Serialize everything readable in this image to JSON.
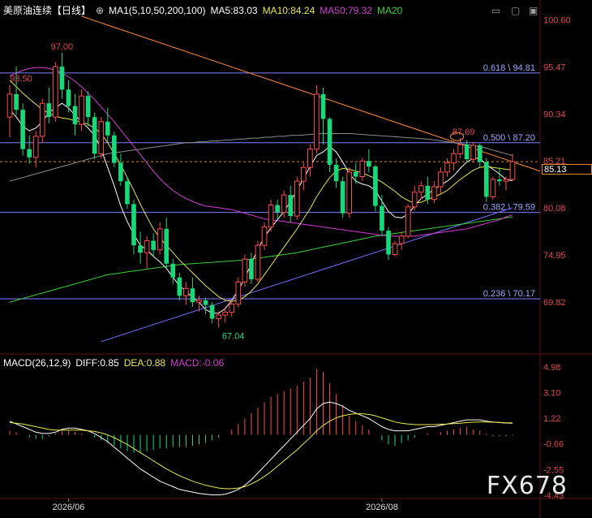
{
  "header": {
    "title": "美原油连续",
    "period": "【日线】",
    "ma_settings": "MA1(5,10,50,200,100)",
    "ma5": "MA5:83.03",
    "ma10": "MA10:84.24",
    "ma50": "MA50:79.32",
    "ma20": "MA20"
  },
  "macd_header": {
    "settings": "MACD(26,12,9)",
    "diff": "DIFF:0.85",
    "dea": "DEA:0.88",
    "macd": "MACD:-0.06"
  },
  "price_axis_labels": [
    "100.60",
    "95.47",
    "90.34",
    "85.21",
    "80.08",
    "74.95",
    "69.82"
  ],
  "macd_axis_labels": [
    "4.98",
    "3.10",
    "1.22",
    "-0.66",
    "-2.55",
    "-4.43"
  ],
  "date_labels": [
    "2026/06",
    "2026/08"
  ],
  "fib_levels": [
    {
      "label": "0.618 \\ 94.81",
      "value": 94.81
    },
    {
      "label": "0.500 \\ 87.20",
      "value": 87.2
    },
    {
      "label": "0.382 \\ 79.59",
      "value": 79.59
    },
    {
      "label": "0.236 \\ 70.17",
      "value": 70.17
    }
  ],
  "annotations": {
    "high1": "97.00",
    "high2": "93.50",
    "high3": "87.69",
    "low1": "67.04"
  },
  "last_price": "85.13",
  "watermark": "FX678",
  "colors": {
    "up": "#ff4b4b",
    "down": "#19d87a",
    "ma5": "#ffffff",
    "ma10": "#e8e84a",
    "ma50": "#d23cd2",
    "ma20": "#3ad03a",
    "ma200": "#8c8c8c",
    "fib": "#7f7fff",
    "trend": "#ff8a3c",
    "support": "#7070ff"
  },
  "chart_data": {
    "type": "candlestick",
    "price_range": [
      64.5,
      101.0
    ],
    "macd_range": [
      -4.43,
      4.98
    ],
    "candles": [
      {
        "o": 90.0,
        "h": 93.5,
        "l": 87.8,
        "c": 92.5
      },
      {
        "o": 92.5,
        "h": 95.5,
        "l": 90.2,
        "c": 90.8
      },
      {
        "o": 90.8,
        "h": 91.5,
        "l": 85.8,
        "c": 86.5
      },
      {
        "o": 86.5,
        "h": 88.0,
        "l": 84.9,
        "c": 85.6
      },
      {
        "o": 85.6,
        "h": 88.5,
        "l": 84.5,
        "c": 87.9
      },
      {
        "o": 87.9,
        "h": 92.0,
        "l": 87.2,
        "c": 91.5
      },
      {
        "o": 91.5,
        "h": 93.2,
        "l": 89.3,
        "c": 90.0
      },
      {
        "o": 90.0,
        "h": 96.0,
        "l": 89.5,
        "c": 95.5
      },
      {
        "o": 95.5,
        "h": 97.0,
        "l": 92.0,
        "c": 93.0
      },
      {
        "o": 93.0,
        "h": 94.0,
        "l": 90.5,
        "c": 91.2
      },
      {
        "o": 91.2,
        "h": 92.5,
        "l": 88.0,
        "c": 89.2
      },
      {
        "o": 89.2,
        "h": 93.0,
        "l": 88.5,
        "c": 92.3
      },
      {
        "o": 92.3,
        "h": 92.8,
        "l": 89.0,
        "c": 90.0
      },
      {
        "o": 90.0,
        "h": 90.5,
        "l": 85.4,
        "c": 86.0
      },
      {
        "o": 86.0,
        "h": 90.0,
        "l": 85.5,
        "c": 89.5
      },
      {
        "o": 89.5,
        "h": 91.0,
        "l": 87.3,
        "c": 88.0
      },
      {
        "o": 88.0,
        "h": 88.4,
        "l": 84.5,
        "c": 85.0
      },
      {
        "o": 85.0,
        "h": 86.0,
        "l": 82.5,
        "c": 83.0
      },
      {
        "o": 83.0,
        "h": 83.5,
        "l": 80.0,
        "c": 80.5
      },
      {
        "o": 80.5,
        "h": 81.0,
        "l": 75.0,
        "c": 76.0
      },
      {
        "o": 76.0,
        "h": 77.5,
        "l": 74.0,
        "c": 75.2
      },
      {
        "o": 75.2,
        "h": 77.0,
        "l": 73.5,
        "c": 76.5
      },
      {
        "o": 76.5,
        "h": 77.3,
        "l": 74.8,
        "c": 75.5
      },
      {
        "o": 75.5,
        "h": 78.5,
        "l": 75.0,
        "c": 77.8
      },
      {
        "o": 77.8,
        "h": 79.0,
        "l": 73.5,
        "c": 74.0
      },
      {
        "o": 74.0,
        "h": 74.5,
        "l": 71.8,
        "c": 72.5
      },
      {
        "o": 72.5,
        "h": 73.0,
        "l": 70.0,
        "c": 70.5
      },
      {
        "o": 70.5,
        "h": 72.0,
        "l": 69.5,
        "c": 71.3
      },
      {
        "o": 71.3,
        "h": 72.5,
        "l": 69.3,
        "c": 69.8
      },
      {
        "o": 69.8,
        "h": 70.5,
        "l": 68.8,
        "c": 70.0
      },
      {
        "o": 70.0,
        "h": 70.3,
        "l": 68.5,
        "c": 69.5
      },
      {
        "o": 69.5,
        "h": 69.8,
        "l": 67.5,
        "c": 68.0
      },
      {
        "o": 68.0,
        "h": 68.8,
        "l": 67.04,
        "c": 68.4
      },
      {
        "o": 68.4,
        "h": 69.3,
        "l": 67.6,
        "c": 68.7
      },
      {
        "o": 68.7,
        "h": 70.0,
        "l": 68.2,
        "c": 69.6
      },
      {
        "o": 69.6,
        "h": 72.5,
        "l": 69.2,
        "c": 72.0
      },
      {
        "o": 72.0,
        "h": 75.0,
        "l": 71.5,
        "c": 74.5
      },
      {
        "o": 74.5,
        "h": 75.2,
        "l": 71.8,
        "c": 72.3
      },
      {
        "o": 72.3,
        "h": 76.5,
        "l": 72.0,
        "c": 76.0
      },
      {
        "o": 76.0,
        "h": 78.5,
        "l": 75.5,
        "c": 78.0
      },
      {
        "o": 78.0,
        "h": 81.0,
        "l": 77.5,
        "c": 80.4
      },
      {
        "o": 80.4,
        "h": 81.0,
        "l": 78.8,
        "c": 79.6
      },
      {
        "o": 79.6,
        "h": 82.0,
        "l": 79.0,
        "c": 81.5
      },
      {
        "o": 81.5,
        "h": 82.5,
        "l": 78.5,
        "c": 79.2
      },
      {
        "o": 79.2,
        "h": 83.5,
        "l": 78.8,
        "c": 83.0
      },
      {
        "o": 83.0,
        "h": 85.0,
        "l": 82.0,
        "c": 84.5
      },
      {
        "o": 84.5,
        "h": 87.0,
        "l": 83.5,
        "c": 86.5
      },
      {
        "o": 86.5,
        "h": 93.5,
        "l": 86.0,
        "c": 92.5
      },
      {
        "o": 92.5,
        "h": 93.2,
        "l": 87.0,
        "c": 89.8
      },
      {
        "o": 89.8,
        "h": 90.0,
        "l": 84.0,
        "c": 84.8
      },
      {
        "o": 84.8,
        "h": 85.5,
        "l": 82.3,
        "c": 83.0
      },
      {
        "o": 83.0,
        "h": 83.5,
        "l": 79.0,
        "c": 79.5
      },
      {
        "o": 79.5,
        "h": 84.5,
        "l": 79.0,
        "c": 84.0
      },
      {
        "o": 84.0,
        "h": 85.0,
        "l": 82.7,
        "c": 83.5
      },
      {
        "o": 83.5,
        "h": 85.5,
        "l": 83.0,
        "c": 85.2
      },
      {
        "o": 85.2,
        "h": 86.5,
        "l": 84.0,
        "c": 84.6
      },
      {
        "o": 84.6,
        "h": 84.8,
        "l": 79.7,
        "c": 80.3
      },
      {
        "o": 80.3,
        "h": 81.5,
        "l": 77.0,
        "c": 77.6
      },
      {
        "o": 77.6,
        "h": 78.0,
        "l": 74.4,
        "c": 75.0
      },
      {
        "o": 75.0,
        "h": 76.5,
        "l": 74.8,
        "c": 76.2
      },
      {
        "o": 76.2,
        "h": 77.5,
        "l": 75.5,
        "c": 77.0
      },
      {
        "o": 77.0,
        "h": 80.5,
        "l": 76.8,
        "c": 80.2
      },
      {
        "o": 80.2,
        "h": 82.5,
        "l": 79.8,
        "c": 81.8
      },
      {
        "o": 81.8,
        "h": 83.0,
        "l": 81.0,
        "c": 82.5
      },
      {
        "o": 82.5,
        "h": 83.5,
        "l": 80.5,
        "c": 81.0
      },
      {
        "o": 81.0,
        "h": 83.0,
        "l": 80.6,
        "c": 82.4
      },
      {
        "o": 82.4,
        "h": 84.5,
        "l": 81.5,
        "c": 84.0
      },
      {
        "o": 84.0,
        "h": 85.5,
        "l": 83.5,
        "c": 85.0
      },
      {
        "o": 85.0,
        "h": 86.5,
        "l": 84.2,
        "c": 86.0
      },
      {
        "o": 86.0,
        "h": 87.69,
        "l": 85.5,
        "c": 87.0
      },
      {
        "o": 87.0,
        "h": 87.5,
        "l": 85.0,
        "c": 85.4
      },
      {
        "o": 85.4,
        "h": 87.3,
        "l": 85.0,
        "c": 86.9
      },
      {
        "o": 86.9,
        "h": 87.1,
        "l": 84.5,
        "c": 85.1
      },
      {
        "o": 85.1,
        "h": 85.5,
        "l": 80.7,
        "c": 81.3
      },
      {
        "o": 81.3,
        "h": 83.5,
        "l": 81.0,
        "c": 83.2
      },
      {
        "o": 83.2,
        "h": 84.5,
        "l": 82.5,
        "c": 83.0
      },
      {
        "o": 83.0,
        "h": 83.5,
        "l": 82.0,
        "c": 83.2
      },
      {
        "o": 83.2,
        "h": 86.0,
        "l": 83.0,
        "c": 85.13
      }
    ],
    "ma5": [
      90.8,
      90.0,
      89.0,
      88.5,
      88.8,
      89.5,
      90.5,
      91.0,
      91.5,
      91.0,
      90.2,
      89.5,
      88.8,
      88.0,
      86.5,
      84.5,
      82.5,
      80.3,
      78.6,
      77.2,
      76.0,
      75.5,
      74.8,
      74.2,
      73.5,
      72.5,
      71.6,
      71.0,
      70.3,
      69.8,
      69.0,
      68.6,
      68.6,
      69.1,
      70.0,
      71.1,
      72.4,
      74.0,
      75.6,
      76.9,
      77.9,
      78.8,
      79.7,
      80.8,
      82.0,
      83.3,
      84.6,
      85.8,
      86.2,
      86.8,
      86.2,
      85.1,
      83.8,
      83.0,
      82.7,
      82.5,
      82.0,
      80.8,
      79.7,
      79.1,
      79.0,
      79.4,
      80.3,
      81.1,
      81.6,
      82.1,
      82.6,
      83.0,
      83.6,
      84.4,
      85.1,
      85.5,
      85.5,
      84.8,
      84.3,
      83.8,
      83.2,
      83.03
    ],
    "ma10": [
      94.0,
      93.3,
      92.6,
      92.0,
      91.4,
      90.8,
      90.4,
      90.1,
      89.9,
      89.8,
      89.6,
      89.5,
      89.2,
      88.8,
      88.2,
      87.2,
      86.0,
      84.8,
      83.4,
      82.0,
      80.5,
      79.1,
      77.8,
      76.8,
      76.0,
      75.2,
      74.4,
      73.7,
      73.0,
      72.3,
      71.6,
      71.0,
      70.4,
      70.0,
      69.9,
      70.0,
      70.4,
      71.0,
      71.8,
      72.8,
      73.8,
      74.8,
      75.8,
      76.8,
      77.8,
      78.9,
      80.0,
      81.3,
      82.4,
      83.4,
      84.1,
      84.4,
      84.3,
      84.1,
      83.9,
      83.6,
      83.3,
      82.9,
      82.4,
      81.9,
      81.3,
      80.9,
      80.6,
      80.7,
      81.0,
      81.3,
      81.6,
      82.0,
      82.6,
      83.2,
      83.7,
      84.2,
      84.5,
      84.6,
      84.5,
      84.4,
      84.3,
      84.24
    ],
    "ma20": [
      69.8,
      70.0,
      70.2,
      70.4,
      70.6,
      70.8,
      71.0,
      71.2,
      71.4,
      71.6,
      71.8,
      72.0,
      72.2,
      72.4,
      72.6,
      72.8,
      72.9,
      73.0,
      73.1,
      73.2,
      73.3,
      73.4,
      73.5,
      73.6,
      73.7,
      73.8,
      73.9,
      73.95,
      74.0,
      74.05,
      74.1,
      74.15,
      74.2,
      74.25,
      74.3,
      74.35,
      74.4,
      74.5,
      74.6,
      74.7,
      74.8,
      74.9,
      75.0,
      75.1,
      75.2,
      75.35,
      75.5,
      75.65,
      75.8,
      75.95,
      76.1,
      76.25,
      76.4,
      76.55,
      76.7,
      76.85,
      77.0,
      77.1,
      77.2,
      77.3,
      77.4,
      77.5,
      77.6,
      77.7,
      77.8,
      77.9,
      78.0,
      78.1,
      78.2,
      78.3,
      78.4,
      78.5,
      78.6,
      78.7,
      78.8,
      78.9,
      79.0,
      79.1
    ],
    "ma50": [
      94.5,
      94.8,
      95.1,
      95.3,
      95.4,
      95.4,
      95.3,
      95.1,
      94.8,
      94.4,
      93.9,
      93.3,
      92.6,
      91.9,
      91.1,
      90.3,
      89.5,
      88.6,
      87.7,
      86.8,
      85.9,
      85.0,
      84.1,
      83.3,
      82.6,
      82.0,
      81.5,
      81.1,
      80.8,
      80.5,
      80.3,
      80.2,
      80.1,
      80.0,
      79.9,
      79.7,
      79.5,
      79.3,
      79.1,
      78.9,
      78.8,
      78.7,
      78.6,
      78.5,
      78.4,
      78.3,
      78.2,
      78.1,
      78.0,
      77.9,
      77.8,
      77.7,
      77.6,
      77.5,
      77.4,
      77.3,
      77.2,
      77.1,
      77.0,
      77.0,
      77.0,
      77.0,
      77.0,
      77.1,
      77.2,
      77.3,
      77.4,
      77.5,
      77.6,
      77.7,
      77.8,
      78.0,
      78.2,
      78.4,
      78.6,
      78.8,
      79.1,
      79.32
    ],
    "ma200": [
      83.0,
      83.2,
      83.4,
      83.6,
      83.8,
      84.0,
      84.2,
      84.4,
      84.6,
      84.8,
      85.0,
      85.2,
      85.4,
      85.6,
      85.8,
      86.0,
      86.1,
      86.2,
      86.3,
      86.4,
      86.5,
      86.6,
      86.7,
      86.8,
      86.9,
      87.0,
      87.1,
      87.2,
      87.2,
      87.3,
      87.3,
      87.4,
      87.4,
      87.5,
      87.5,
      87.6,
      87.6,
      87.7,
      87.7,
      87.8,
      87.8,
      87.9,
      87.9,
      88.0,
      88.0,
      88.05,
      88.1,
      88.15,
      88.2,
      88.2,
      88.2,
      88.2,
      88.2,
      88.15,
      88.1,
      88.05,
      88.0,
      87.95,
      87.9,
      87.85,
      87.8,
      87.75,
      87.7,
      87.65,
      87.6,
      87.5,
      87.4,
      87.3,
      87.2,
      87.1,
      87.0,
      86.9,
      86.8,
      86.6,
      86.4,
      86.2,
      86.0,
      85.8
    ],
    "macd_hist": [
      0.3,
      0.2,
      0.0,
      -0.2,
      -0.3,
      -0.3,
      -0.1,
      0.1,
      0.3,
      0.3,
      0.2,
      0.1,
      0.0,
      -0.2,
      -0.4,
      -0.6,
      -0.8,
      -1.0,
      -1.2,
      -1.3,
      -1.3,
      -1.2,
      -1.1,
      -1.0,
      -1.0,
      -0.9,
      -0.9,
      -0.9,
      -0.8,
      -0.7,
      -0.6,
      -0.4,
      -0.2,
      0.0,
      0.4,
      0.8,
      1.2,
      1.6,
      2.0,
      2.4,
      2.8,
      3.0,
      3.2,
      3.4,
      3.6,
      3.9,
      4.2,
      4.8,
      4.6,
      3.8,
      3.0,
      2.2,
      1.4,
      1.0,
      0.7,
      0.4,
      0.0,
      -0.4,
      -0.7,
      -0.8,
      -0.6,
      -0.4,
      -0.2,
      0.0,
      0.1,
      0.0,
      0.2,
      0.3,
      0.4,
      0.5,
      0.6,
      0.4,
      0.3,
      0.1,
      -0.1,
      -0.1,
      -0.1,
      -0.06
    ],
    "diff": [
      1.0,
      0.8,
      0.6,
      0.4,
      0.2,
      0.1,
      0.1,
      0.2,
      0.4,
      0.5,
      0.5,
      0.4,
      0.3,
      0.1,
      -0.2,
      -0.5,
      -0.9,
      -1.3,
      -1.7,
      -2.1,
      -2.5,
      -2.8,
      -3.1,
      -3.4,
      -3.6,
      -3.8,
      -4.0,
      -4.1,
      -4.2,
      -4.3,
      -4.35,
      -4.4,
      -4.4,
      -4.35,
      -4.2,
      -4.0,
      -3.7,
      -3.3,
      -2.8,
      -2.3,
      -1.8,
      -1.3,
      -0.8,
      -0.3,
      0.2,
      0.7,
      1.2,
      1.9,
      2.3,
      2.4,
      2.3,
      2.1,
      1.8,
      1.6,
      1.4,
      1.2,
      0.9,
      0.6,
      0.4,
      0.3,
      0.3,
      0.3,
      0.4,
      0.5,
      0.6,
      0.6,
      0.7,
      0.8,
      0.9,
      1.0,
      1.1,
      1.1,
      1.1,
      1.0,
      0.95,
      0.9,
      0.87,
      0.85
    ],
    "dea": [
      0.9,
      0.85,
      0.8,
      0.7,
      0.6,
      0.5,
      0.4,
      0.35,
      0.35,
      0.35,
      0.35,
      0.35,
      0.3,
      0.25,
      0.15,
      0.0,
      -0.2,
      -0.45,
      -0.7,
      -1.0,
      -1.3,
      -1.6,
      -1.9,
      -2.2,
      -2.5,
      -2.75,
      -3.0,
      -3.2,
      -3.4,
      -3.55,
      -3.7,
      -3.8,
      -3.9,
      -3.95,
      -3.95,
      -3.9,
      -3.8,
      -3.6,
      -3.35,
      -3.05,
      -2.7,
      -2.3,
      -1.9,
      -1.5,
      -1.1,
      -0.65,
      -0.2,
      0.3,
      0.7,
      1.0,
      1.25,
      1.4,
      1.5,
      1.55,
      1.55,
      1.5,
      1.4,
      1.25,
      1.1,
      0.95,
      0.85,
      0.8,
      0.75,
      0.75,
      0.75,
      0.75,
      0.78,
      0.8,
      0.83,
      0.86,
      0.9,
      0.93,
      0.95,
      0.95,
      0.93,
      0.91,
      0.89,
      0.88
    ]
  }
}
